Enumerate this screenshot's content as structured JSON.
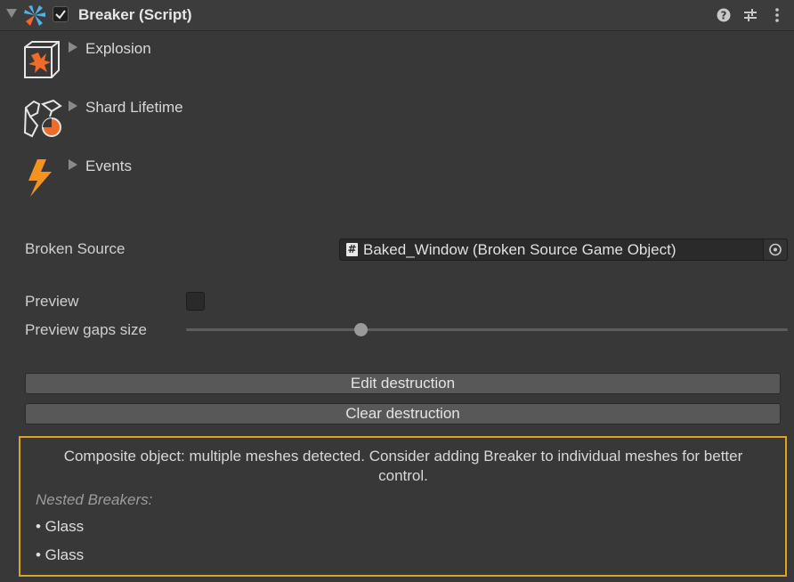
{
  "header": {
    "title": "Breaker (Script)",
    "enabled": true,
    "icons": [
      "fold-arrow-icon",
      "breaker-script-icon",
      "help-icon",
      "preset-icon",
      "kebab-menu-icon"
    ]
  },
  "sections": [
    {
      "label": "Explosion",
      "icon": "explosion-icon"
    },
    {
      "label": "Shard Lifetime",
      "icon": "shard-lifetime-icon"
    },
    {
      "label": "Events",
      "icon": "events-lightning-icon"
    }
  ],
  "fields": {
    "broken_source_label": "Broken Source",
    "broken_source_value": "Baked_Window (Broken Source Game Object)",
    "preview_label": "Preview",
    "preview_checked": false,
    "gaps_label": "Preview gaps size",
    "gaps_value_fraction": 0.29
  },
  "buttons": {
    "edit": "Edit destruction",
    "clear": "Clear destruction"
  },
  "help": {
    "message": "Composite object: multiple meshes detected. Consider adding Breaker to individual meshes for better control.",
    "nested_title": "Nested Breakers:",
    "nested_items": [
      "• Glass",
      "• Glass"
    ]
  },
  "colors": {
    "accent_orange": "#f06a2a",
    "warning_border": "#e2a11f",
    "icon_blue": "#4fb3e8"
  }
}
